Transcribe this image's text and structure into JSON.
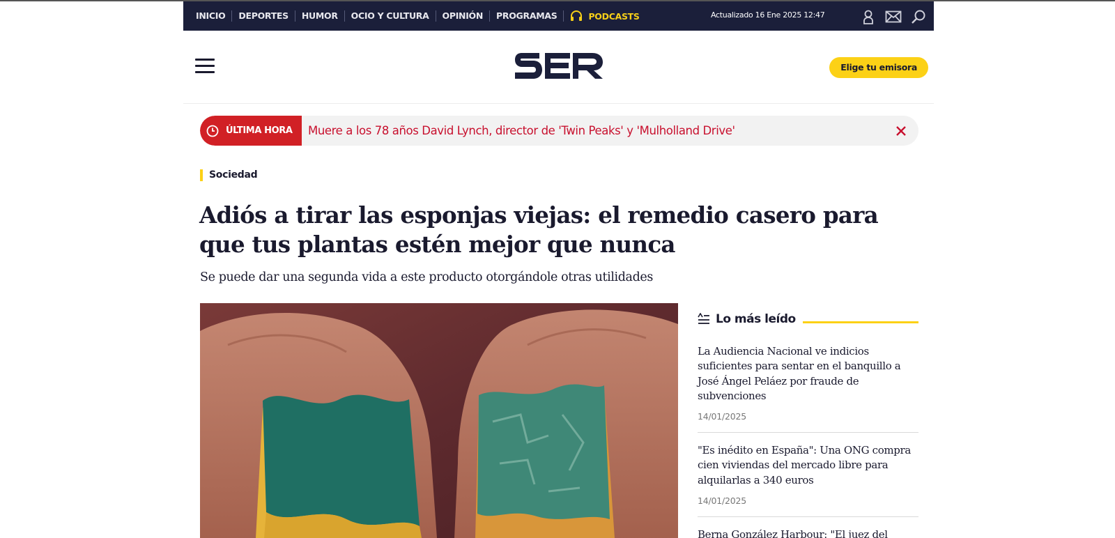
{
  "nav": {
    "items": [
      "INICIO",
      "DEPORTES",
      "HUMOR",
      "OCIO Y CULTURA",
      "OPINIÓN",
      "PROGRAMAS"
    ],
    "podcasts_label": "PODCASTS",
    "updated": "Actualizado 16 Ene 2025 12:47",
    "icons": [
      "user-icon",
      "mail-icon",
      "search-icon"
    ]
  },
  "header": {
    "logo_text": "SER",
    "emisora_button": "Elige tu emisora"
  },
  "breaking": {
    "tag": "ÚLTIMA HORA",
    "text": "Muere a los 78 años David Lynch, director de 'Twin Peaks' y 'Mulholland Drive'"
  },
  "article": {
    "section": "Sociedad",
    "headline": "Adiós a tirar las esponjas viejas: el remedio casero para que tus plantas estén mejor que nunca",
    "subtitle": "Se puede dar una segunda vida a este producto otorgándole otras utilidades"
  },
  "most_read": {
    "title": "Lo más leído",
    "items": [
      {
        "title": "La Audiencia Nacional ve indicios suficientes para sentar en el banquillo a José Ángel Peláez por fraude de subvenciones",
        "date": "14/01/2025"
      },
      {
        "title": "\"Es inédito en España\": Una ONG compra cien viviendas del mercado libre para alquilarlas a 340 euros",
        "date": "14/01/2025"
      },
      {
        "title": "Berna González Harbour: \"El juez del",
        "date": ""
      }
    ]
  },
  "colors": {
    "navy": "#1b1f3a",
    "yellow": "#fcd116",
    "red": "#d12025"
  }
}
